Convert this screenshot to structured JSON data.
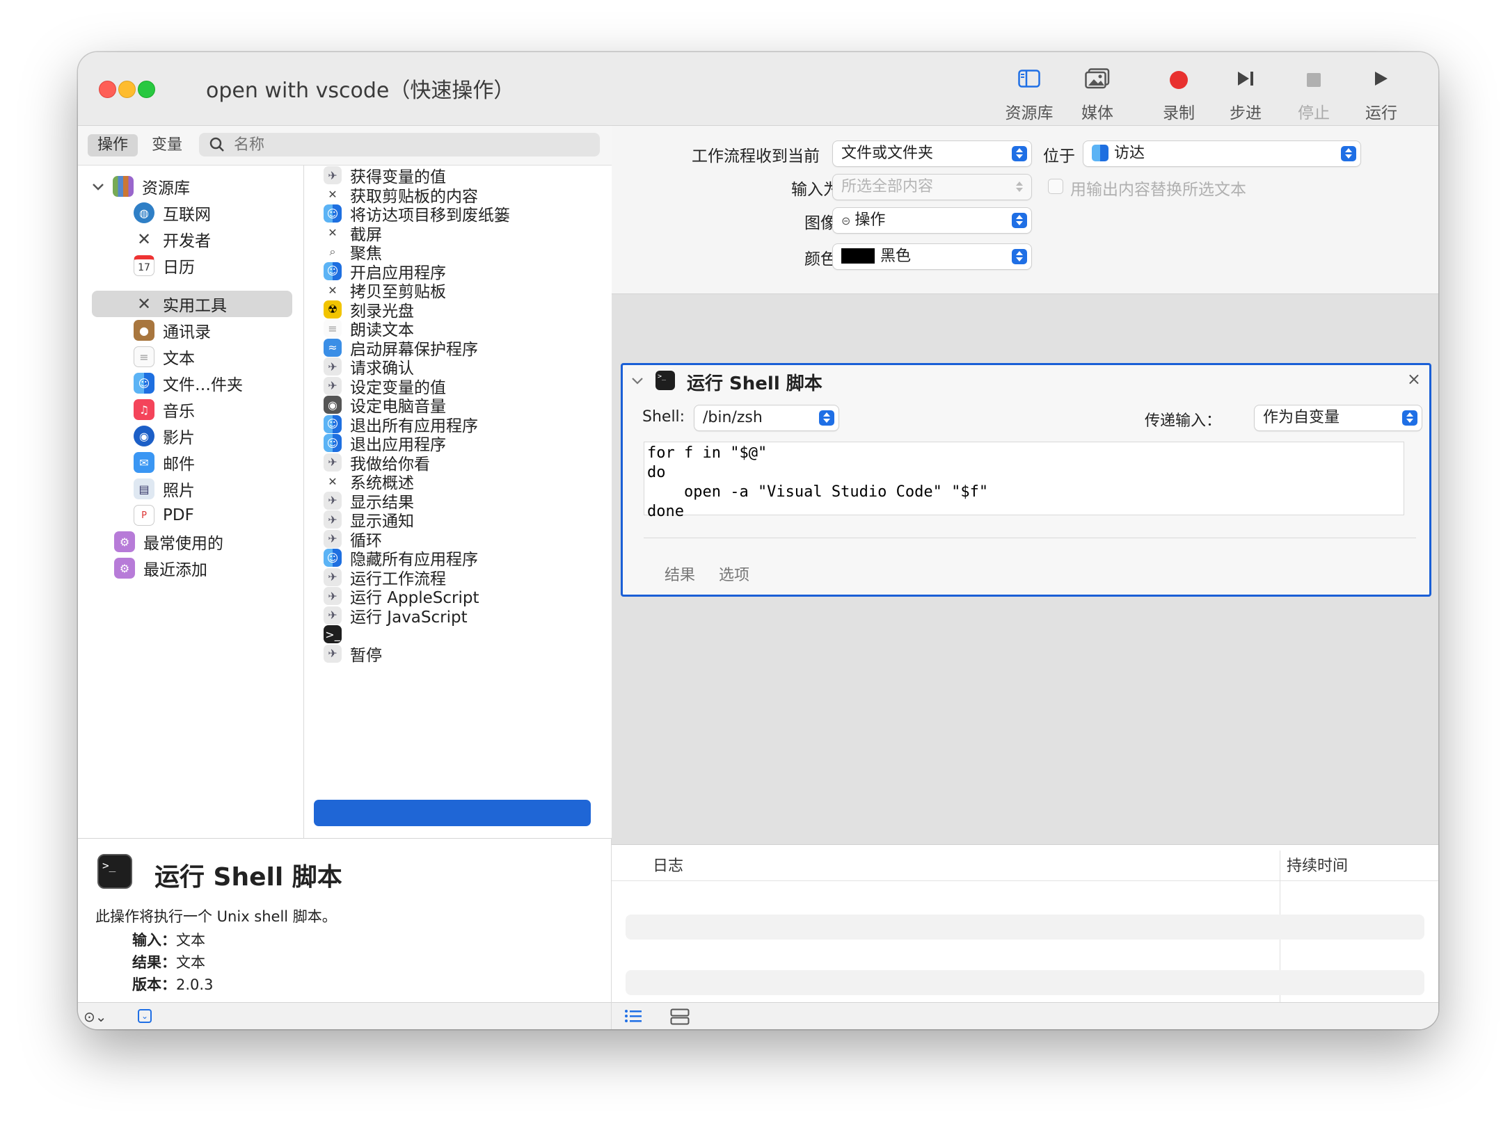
{
  "window": {
    "title": "open with vscode（快速操作）"
  },
  "toolbar": {
    "library": "资源库",
    "media": "媒体",
    "record": "录制",
    "step": "步进",
    "stop": "停止",
    "run": "运行"
  },
  "left": {
    "tab_actions": "操作",
    "tab_variables": "变量",
    "search_placeholder": "名称",
    "categories": [
      "资源库",
      "互联网",
      "开发者",
      "日历",
      "实用工具",
      "通讯录",
      "文本",
      "文件…件夹",
      "音乐",
      "影片",
      "邮件",
      "照片",
      "PDF",
      "最常使用的",
      "最近添加"
    ],
    "actions": [
      "获得变量的值",
      "获取剪贴板的内容",
      "将访达项目移到废纸篓",
      "截屏",
      "聚焦",
      "开启应用程序",
      "拷贝至剪贴板",
      "刻录光盘",
      "朗读文本",
      "启动屏幕保护程序",
      "请求确认",
      "设定变量的值",
      "设定电脑音量",
      "退出所有应用程序",
      "退出应用程序",
      "我做给你看",
      "系统概述",
      "显示结果",
      "显示通知",
      "循环",
      "隐藏所有应用程序",
      "运行工作流程",
      "运行 AppleScript",
      "运行 JavaScript",
      "运行 Shell 脚本",
      "暂停"
    ],
    "description": {
      "title": "运行 Shell 脚本",
      "text": "此操作将执行一个 Unix shell 脚本。",
      "input_label": "输入：",
      "input_value": "文本",
      "result_label": "结果：",
      "result_value": "文本",
      "version_label": "版本：",
      "version_value": "2.0.3"
    }
  },
  "workflow": {
    "receives_label": "工作流程收到当前",
    "receives_value": "文件或文件夹",
    "in_label": "位于",
    "in_value": "访达",
    "input_is_label": "输入为",
    "input_is_value": "所选全部内容",
    "replace_label": "用输出内容替换所选文本",
    "image_label": "图像",
    "image_value": "操作",
    "color_label": "颜色",
    "color_value": "黑色",
    "color_swatch": "#000000"
  },
  "action_card": {
    "title": "运行 Shell 脚本",
    "shell_label": "Shell:",
    "shell_value": "/bin/zsh",
    "pass_input_label": "传递输入：",
    "pass_input_value": "作为自变量",
    "script": "for f in \"$@\"\ndo\n    open -a \"Visual Studio Code\" \"$f\"\ndone",
    "tab_results": "结果",
    "tab_options": "选项"
  },
  "log": {
    "col_log": "日志",
    "col_duration": "持续时间"
  },
  "colors": {
    "accent": "#1f66d6",
    "close": "#fe5f57",
    "minimize": "#febc2e",
    "zoom": "#28c840",
    "record": "#e8312f"
  }
}
